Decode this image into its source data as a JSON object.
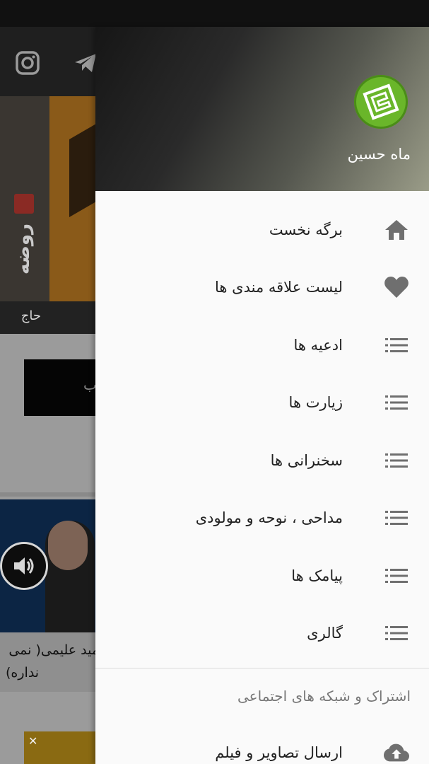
{
  "colors": {
    "status_bar": "#111111",
    "drawer_bg": "#fafafa",
    "logo_green": "#6ab62a",
    "icon_gray": "#6f6f6f",
    "text_dark": "#222222",
    "section_gray": "#777777"
  },
  "background_app": {
    "toolbar_icons": [
      "instagram-icon",
      "telegram-icon"
    ],
    "banner_vertical_text": "روضه",
    "banner_caption": "حاج",
    "black_box_text": "ب",
    "video_card_line1": "مید علیمی( نمی",
    "video_card_line2": "نداره)"
  },
  "drawer": {
    "header": {
      "logo_icon": "kufic-logo-icon",
      "title": "ماه حسین"
    },
    "items": [
      {
        "label": "برگه نخست",
        "icon": "home-icon"
      },
      {
        "label": "لیست علاقه مندی ها",
        "icon": "heart-icon"
      },
      {
        "label": "ادعیه ها",
        "icon": "list-icon"
      },
      {
        "label": "زیارت ها",
        "icon": "list-icon"
      },
      {
        "label": "سخنرانی ها",
        "icon": "list-icon"
      },
      {
        "label": "مداحی ، نوحه و مولودی",
        "icon": "list-icon"
      },
      {
        "label": "پیامک ها",
        "icon": "list-icon"
      },
      {
        "label": "گالری",
        "icon": "list-icon"
      }
    ],
    "section_title": "اشتراک و شبکه های اجتماعی",
    "upload_item": {
      "label": "ارسال تصاویر و فیلم",
      "icon": "cloud-upload-icon"
    }
  }
}
